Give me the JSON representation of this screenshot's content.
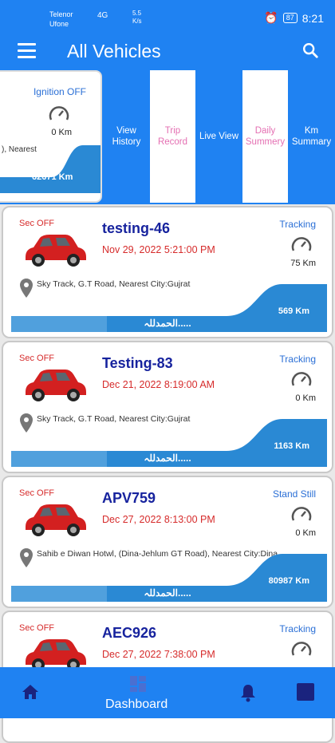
{
  "status_bar": {
    "carrier_1": "Telenor",
    "carrier_2": "Ufone",
    "signal": "4G",
    "speed_value": "5.5",
    "speed_unit": "K/s",
    "battery": "87",
    "time": "8:21"
  },
  "app": {
    "title": "All Vehicles"
  },
  "selected": {
    "ignition": "Ignition OFF",
    "km": "0 Km",
    "address": "), Nearest",
    "total": "62671 Km"
  },
  "options": [
    {
      "label": "View History"
    },
    {
      "label": "Trip Record"
    },
    {
      "label": "Live View"
    },
    {
      "label": "Daily Summery"
    },
    {
      "label": "Km Summary"
    }
  ],
  "vehicles": [
    {
      "security": "Sec OFF",
      "name": "testing-46",
      "datetime": "Nov 29, 2022  5:21:00 PM",
      "status": "Tracking",
      "km": "75 Km",
      "address": "Sky Track, G.T Road, Nearest City:Gujrat",
      "total": "569 Km",
      "footer": "الحمدللہ....."
    },
    {
      "security": "Sec OFF",
      "name": "Testing-83",
      "datetime": "Dec 21, 2022  8:19:00 AM",
      "status": "Tracking",
      "km": "0 Km",
      "address": "Sky Track, G.T Road, Nearest City:Gujrat",
      "total": "1163 Km",
      "footer": "الحمدللہ....."
    },
    {
      "security": "Sec OFF",
      "name": "APV759",
      "datetime": "Dec 27, 2022  8:13:00 PM",
      "status": "Stand Still",
      "km": "0 Km",
      "address": "Sahib e Diwan Hotwl, (Dina-Jehlum GT Road), Nearest City:Dina",
      "total": "80987 Km",
      "footer": "الحمدللہ....."
    },
    {
      "security": "Sec OFF",
      "name": "AEC926",
      "datetime": "Dec 27, 2022  7:38:00 PM",
      "status": "Tracking",
      "km": "",
      "address": "",
      "total": "",
      "footer": ""
    }
  ],
  "bottom_nav": {
    "dashboard": "Dashboard"
  },
  "colors": {
    "primary": "#1f82f2",
    "name": "#17239e",
    "alert": "#d62b2b",
    "status": "#2a6fd6"
  }
}
